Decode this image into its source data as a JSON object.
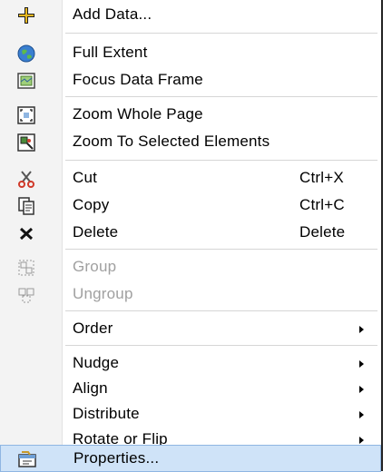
{
  "menu": {
    "items": [
      {
        "label": "Add Data...",
        "icon": "add-data-icon"
      },
      {
        "label": "Full Extent",
        "icon": "globe-icon"
      },
      {
        "label": "Focus Data Frame",
        "icon": "focus-frame-icon"
      },
      {
        "label": "Zoom Whole Page",
        "icon": "zoom-page-icon"
      },
      {
        "label": "Zoom To Selected Elements",
        "icon": "zoom-selected-icon"
      },
      {
        "label": "Cut",
        "shortcut": "Ctrl+X",
        "icon": "scissors-icon"
      },
      {
        "label": "Copy",
        "shortcut": "Ctrl+C",
        "icon": "copy-icon"
      },
      {
        "label": "Delete",
        "shortcut": "Delete",
        "icon": "delete-x-icon"
      },
      {
        "label": "Group",
        "icon": "group-icon",
        "disabled": true
      },
      {
        "label": "Ungroup",
        "icon": "ungroup-icon",
        "disabled": true
      },
      {
        "label": "Order",
        "submenu": true
      },
      {
        "label": "Nudge",
        "submenu": true
      },
      {
        "label": "Align",
        "submenu": true
      },
      {
        "label": "Distribute",
        "submenu": true
      },
      {
        "label": "Rotate or Flip",
        "submenu": true
      },
      {
        "label": "Properties...",
        "icon": "properties-icon",
        "highlighted": true
      }
    ]
  },
  "colors": {
    "highlight": "#cfe3f8",
    "disabled_text": "#a0a0a0",
    "gutter": "#f3f3f3"
  }
}
